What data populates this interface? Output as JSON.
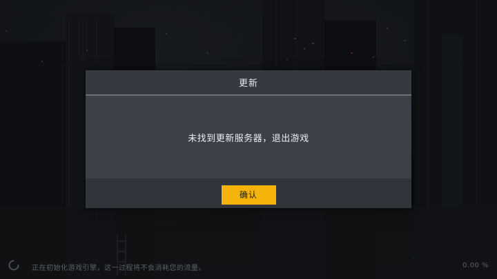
{
  "dialog": {
    "title": "更新",
    "message": "未找到更新服务器，退出游戏",
    "confirm_label": "确认"
  },
  "loading": {
    "status_text": "正在初始化游戏引擎，这一过程将不会消耗您的流量。",
    "progress_percent": "0.00 %",
    "progress_value": 0
  },
  "colors": {
    "accent": "#f4b40c",
    "dialog_bg": "#3c4048",
    "dialog_header_bg": "#353941",
    "dialog_footer_bg": "#30343b",
    "background": "#0d0f12"
  },
  "icons": {
    "spinner": "loading-spinner-icon"
  }
}
